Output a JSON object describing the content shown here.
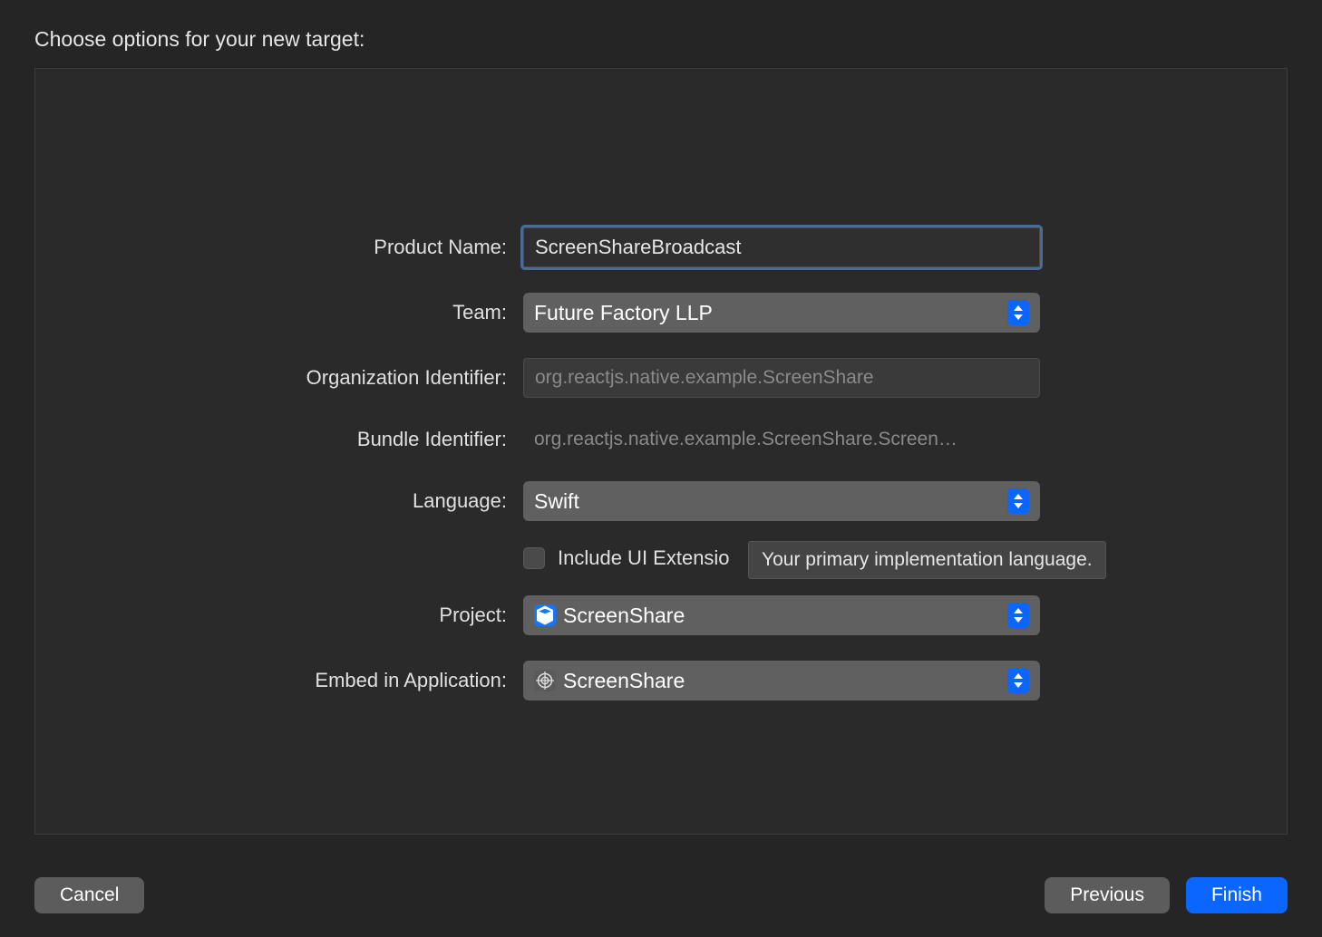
{
  "title": "Choose options for your new target:",
  "labels": {
    "product_name": "Product Name:",
    "team": "Team:",
    "org_id": "Organization Identifier:",
    "bundle_id": "Bundle Identifier:",
    "language": "Language:",
    "include_ui": "Include UI Extensio",
    "project": "Project:",
    "embed": "Embed in Application:"
  },
  "values": {
    "product_name": "ScreenShareBroadcast",
    "team": "Future Factory LLP",
    "org_id": "org.reactjs.native.example.ScreenShare",
    "bundle_id": "org.reactjs.native.example.ScreenShare.Screen…",
    "language": "Swift",
    "project": "ScreenShare",
    "embed": "ScreenShare",
    "include_ui_checked": false
  },
  "tooltip": "Your primary implementation language.",
  "buttons": {
    "cancel": "Cancel",
    "previous": "Previous",
    "finish": "Finish"
  }
}
